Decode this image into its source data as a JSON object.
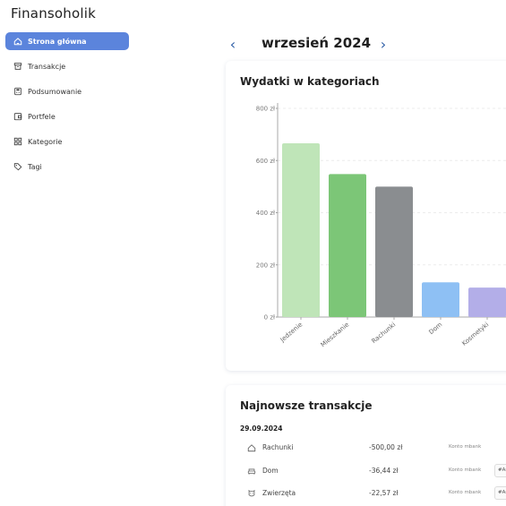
{
  "app": {
    "title": "Finansoholik"
  },
  "sidebar": {
    "items": [
      {
        "label": "Strona główna",
        "icon": "home-icon",
        "active": true
      },
      {
        "label": "Transakcje",
        "icon": "box-icon",
        "active": false
      },
      {
        "label": "Podsumowanie",
        "icon": "calculator-icon",
        "active": false
      },
      {
        "label": "Portfele",
        "icon": "wallet-icon",
        "active": false
      },
      {
        "label": "Kategorie",
        "icon": "grid-icon",
        "active": false
      },
      {
        "label": "Tagi",
        "icon": "tag-icon",
        "active": false
      }
    ],
    "accent": "#5b84dc"
  },
  "month": {
    "prev": "‹",
    "title": "wrzesień 2024",
    "next": "›"
  },
  "expenses_card": {
    "title": "Wydatki w kategoriach"
  },
  "chart_data": {
    "type": "bar",
    "categories": [
      "Jedzenie",
      "Mieszkanie",
      "Rachunki",
      "Dom",
      "Kosmetyki"
    ],
    "values": [
      666,
      548,
      500,
      133,
      113
    ],
    "colors": [
      "#bfe5b8",
      "#7cc677",
      "#8a8d90",
      "#8ec0f4",
      "#b3aee8"
    ],
    "yticks": [
      "0 zł",
      "200 zł",
      "400 zł",
      "600 zł",
      "800 zł"
    ],
    "ylim": [
      0,
      800
    ],
    "grid": true,
    "title": "",
    "xlabel": "",
    "ylabel": ""
  },
  "transactions_card": {
    "title": "Najnowsze transakcje",
    "date": "29.09.2024",
    "rows": [
      {
        "name": "Rachunki",
        "amount": "-500,00 zł",
        "account": "Konto mbank",
        "icon": "home-icon",
        "tag": ""
      },
      {
        "name": "Dom",
        "amount": "-36,44 zł",
        "account": "Konto mbank",
        "icon": "sofa-icon",
        "tag": "#An"
      },
      {
        "name": "Zwierzęta",
        "amount": "-22,57 zł",
        "account": "Konto mbank",
        "icon": "pet-icon",
        "tag": "#An"
      }
    ]
  }
}
